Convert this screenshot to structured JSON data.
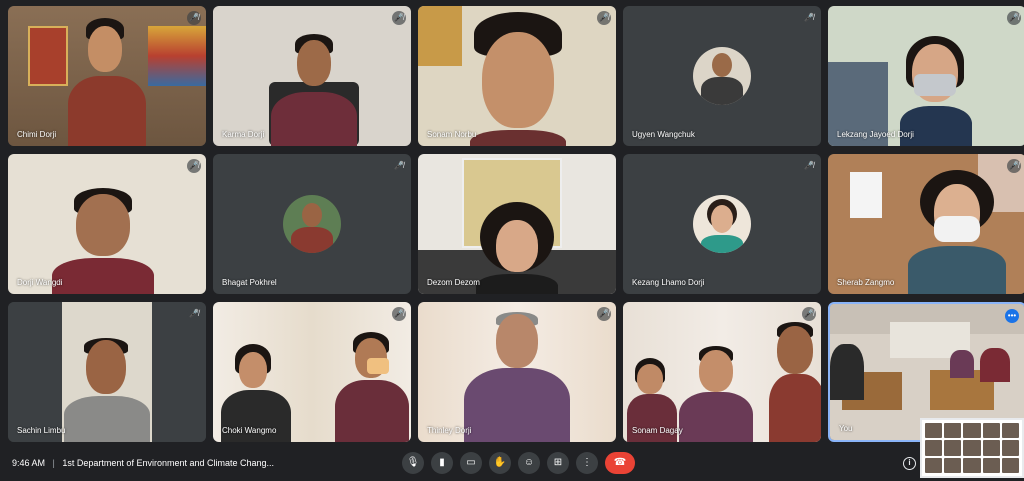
{
  "participants": [
    {
      "name": "Chimi Dorji",
      "muted": true
    },
    {
      "name": "Karma Dorji",
      "muted": true
    },
    {
      "name": "Sonam Norbu",
      "muted": true
    },
    {
      "name": "Ugyen Wangchuk",
      "muted": true
    },
    {
      "name": "Lekzang Jayoed Dorji",
      "muted": true
    },
    {
      "name": "Dorji Wangdi",
      "muted": true
    },
    {
      "name": "Bhagat Pokhrel",
      "muted": true
    },
    {
      "name": "Dezom Dezom",
      "muted": false
    },
    {
      "name": "Kezang Lhamo Dorji",
      "muted": true
    },
    {
      "name": "Sherab Zangmo",
      "muted": true
    },
    {
      "name": "Sachin Limbu",
      "muted": true
    },
    {
      "name": "Choki Wangmo",
      "muted": true
    },
    {
      "name": "Thinley Dorji",
      "muted": true
    },
    {
      "name": "Sonam Dagay",
      "muted": true
    },
    {
      "name": "You",
      "muted": false
    }
  ],
  "meeting": {
    "time": "9:46 AM",
    "separator": "|",
    "title": "1st Department of Environment and Climate Chang..."
  },
  "controls": [
    {
      "name": "microphone-button",
      "icon": "microphone-icon",
      "glyph": "🎙"
    },
    {
      "name": "camera-button",
      "icon": "camera-icon",
      "glyph": "▮"
    },
    {
      "name": "captions-button",
      "icon": "captions-icon",
      "glyph": "▭"
    },
    {
      "name": "raise-hand-button",
      "icon": "hand-icon",
      "glyph": "✋"
    },
    {
      "name": "emoji-button",
      "icon": "emoji-icon",
      "glyph": "☺"
    },
    {
      "name": "present-button",
      "icon": "present-icon",
      "glyph": "⊞"
    },
    {
      "name": "more-options-button",
      "icon": "more-vert-icon",
      "glyph": "⋮"
    },
    {
      "name": "end-call-button",
      "icon": "end-call-icon",
      "glyph": "☎"
    }
  ],
  "icons": {
    "muted": "🎤̸",
    "info": "i",
    "more": "•••"
  },
  "colors": {
    "background": "#202124",
    "tile": "#3c4043",
    "end_call": "#ea4335",
    "self_highlight": "#8ab4f8"
  }
}
